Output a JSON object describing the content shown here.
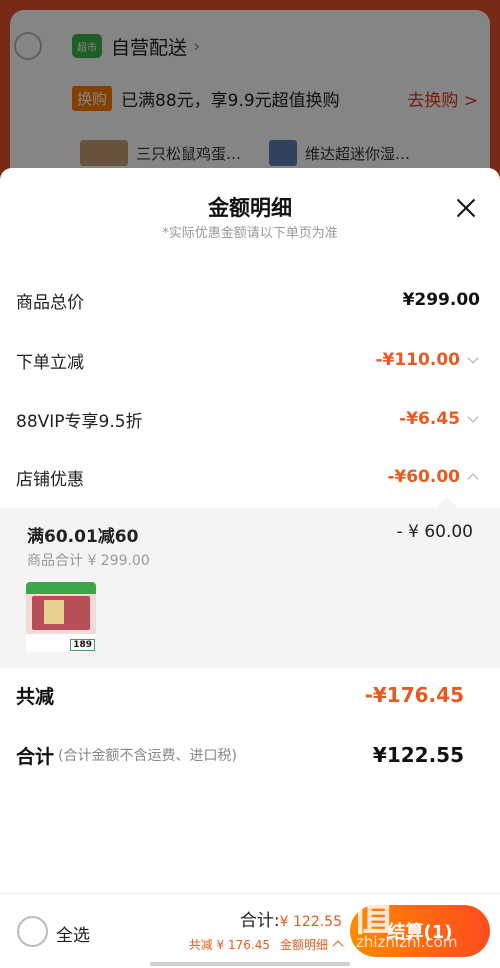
{
  "background_cart": {
    "store_logo": "超市",
    "store_name": "自营配送",
    "promo_tag": "换购",
    "promo_text": "已满88元，享9.9元超值换购",
    "promo_link": "去换购 >",
    "items": [
      "三只松鼠鸡蛋…",
      "维达超迷你湿…"
    ]
  },
  "sheet": {
    "title": "金额明细",
    "subtitle": "*实际优惠金额请以下单页为准",
    "rows": [
      {
        "label": "商品总价",
        "value": "¥299.00"
      },
      {
        "label": "下单立减",
        "value": "-¥110.00"
      },
      {
        "label": "88VIP专享9.5折",
        "value": "-¥6.45"
      },
      {
        "label": "店铺优惠",
        "value": "-¥60.00"
      }
    ],
    "store_discount_detail": {
      "title": "满60.01减60",
      "value": "- ¥ 60.00",
      "meta": "商品合计 ¥ 299.00",
      "product_price_badge": "189"
    },
    "total_discount": {
      "label": "共减",
      "value": "-¥176.45"
    },
    "grand_total": {
      "label": "合计",
      "note": "(合计金额不含运费、进口税)",
      "value": "¥122.55"
    }
  },
  "bottom_bar": {
    "select_all": "全选",
    "sum_label": "合计:",
    "sum_value": "¥ 122.55",
    "discount_text": "共减 ¥ 176.45",
    "detail_link": "金额明细",
    "checkout_label": "结算(1)"
  },
  "watermark": {
    "logo": "值",
    "site": "zhizhizhi.com"
  }
}
